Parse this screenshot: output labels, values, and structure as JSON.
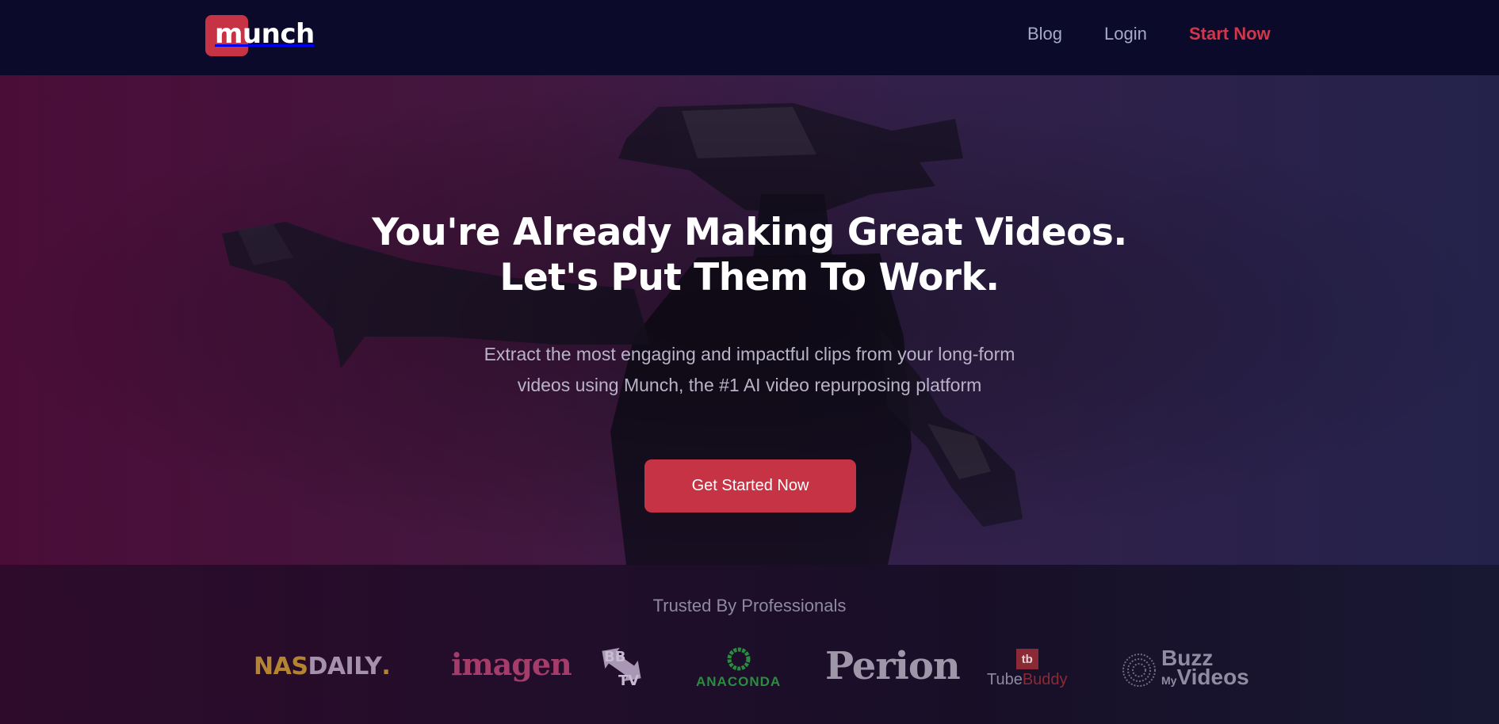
{
  "header": {
    "logo_text": "munch",
    "nav": [
      {
        "label": "Blog"
      },
      {
        "label": "Login"
      },
      {
        "label": "Start Now"
      }
    ]
  },
  "hero": {
    "headline_line1": "You're Already Making Great Videos.",
    "headline_line2": "Let's Put Them To Work.",
    "subtitle_line1": "Extract the most engaging and impactful clips from your long-form",
    "subtitle_line2": "videos using Munch, the #1 AI video repurposing platform",
    "cta_label": "Get Started Now"
  },
  "trusted": {
    "title": "Trusted By Professionals",
    "logos": {
      "nasdaily": {
        "part1": "NAS",
        "part2": "DAILY",
        "dot": "."
      },
      "imagen": {
        "text": "imagen"
      },
      "bbtv": {
        "text": "BBTV"
      },
      "anaconda": {
        "text": "ANACONDA"
      },
      "perion": {
        "text": "Perion"
      },
      "tubebuddy": {
        "badge": "tb",
        "part1": "Tube",
        "part2": "Buddy"
      },
      "buzzmyvideos": {
        "line1": "Buzz",
        "my": "My",
        "line2": "Videos"
      }
    }
  },
  "colors": {
    "brand": "#c63344",
    "header_bg": "#0b0a2a",
    "nav_text": "#a6a9c9",
    "cta_nav": "#d2364a"
  }
}
